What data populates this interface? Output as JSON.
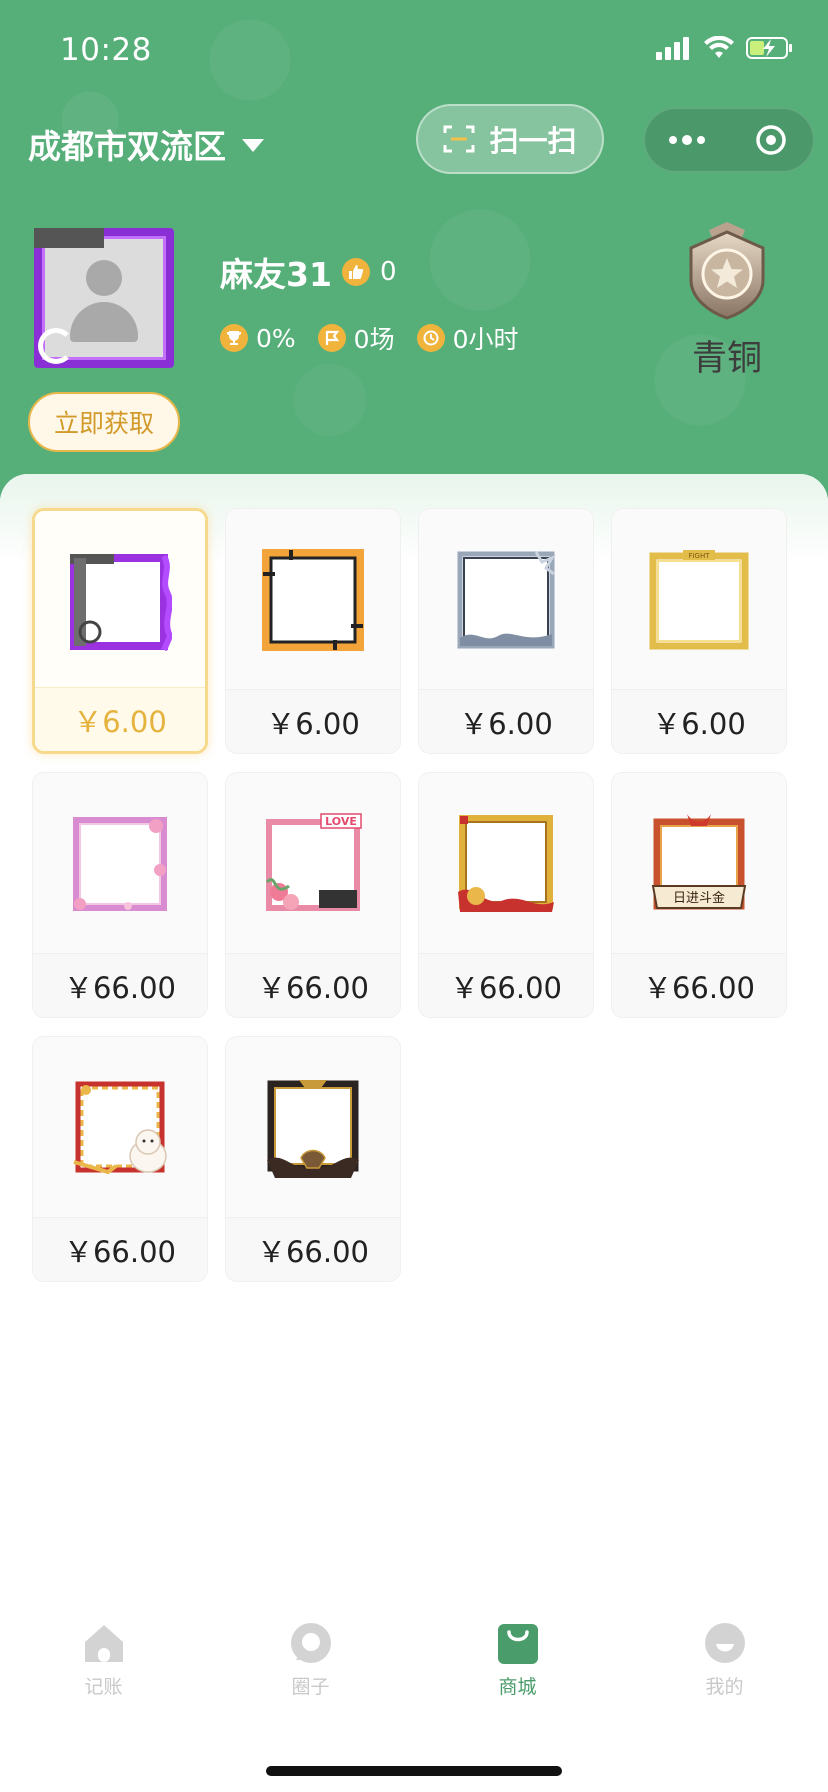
{
  "status_bar": {
    "time": "10:28"
  },
  "header": {
    "city": "成都市双流区",
    "scan_label": "扫一扫",
    "capsule": {
      "more_icon": "more-dots-icon",
      "close_icon": "target-circle-icon"
    }
  },
  "profile": {
    "username": "麻友31",
    "likes": "0",
    "stats": {
      "win_rate": "0%",
      "games": "0场",
      "hours": "0小时"
    },
    "rank": "青铜",
    "get_button": "立即获取"
  },
  "shop": {
    "items": [
      {
        "price": "￥6.00",
        "selected": true,
        "frame": "purple-flame"
      },
      {
        "price": "￥6.00",
        "selected": false,
        "frame": "orange-tech"
      },
      {
        "price": "￥6.00",
        "selected": false,
        "frame": "ink-wash"
      },
      {
        "price": "￥6.00",
        "selected": false,
        "frame": "gold-fight"
      },
      {
        "price": "￥66.00",
        "selected": false,
        "frame": "pink-blossom"
      },
      {
        "price": "￥66.00",
        "selected": false,
        "frame": "love-roses"
      },
      {
        "price": "￥66.00",
        "selected": false,
        "frame": "gold-ribbon"
      },
      {
        "price": "￥66.00",
        "selected": false,
        "frame": "red-scroll"
      },
      {
        "price": "￥66.00",
        "selected": false,
        "frame": "lucky-cat"
      },
      {
        "price": "￥66.00",
        "selected": false,
        "frame": "black-gold-helmet"
      }
    ],
    "scroll_text": "日进斗金",
    "love_text": "LOVE",
    "fight_text": "FIGHT"
  },
  "tabbar": {
    "tabs": [
      {
        "label": "记账",
        "icon": "home-icon"
      },
      {
        "label": "圈子",
        "icon": "circle-icon"
      },
      {
        "label": "商城",
        "icon": "shopping-bag-icon",
        "active": true
      },
      {
        "label": "我的",
        "icon": "smile-icon"
      }
    ]
  },
  "colors": {
    "header_green": "#56ae79",
    "accent_gold": "#e6b23e",
    "active_tab": "#4a9d6b"
  }
}
